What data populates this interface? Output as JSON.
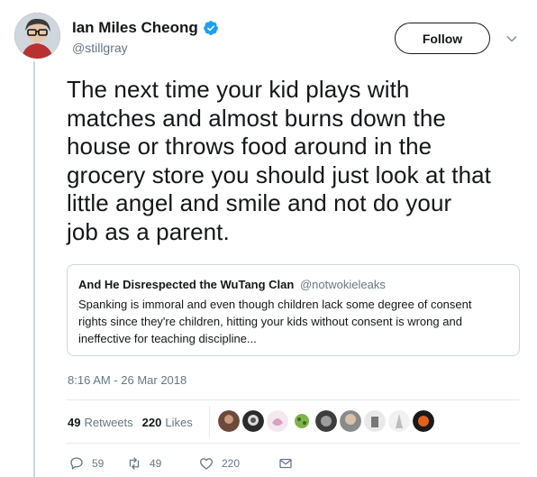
{
  "author": {
    "name": "Ian Miles Cheong",
    "handle": "@stillgray",
    "verified": true
  },
  "follow_label": "Follow",
  "tweet": {
    "lines": [
      "The next time your kid plays with",
      "matches and almost burns down the",
      "house or throws food around in the",
      "grocery store you should just look at that",
      "little angel and smile and not do your",
      "job as a parent."
    ]
  },
  "quote": {
    "name": "And He Disrespected the WuTang Clan",
    "handle": "@notwokieleaks",
    "lines": [
      "Spanking is immoral and even though children lack some degree of consent",
      "rights since they're children, hitting your kids without consent is wrong and",
      "ineffective for teaching discipline..."
    ]
  },
  "timestamp": "8:16 AM - 26 Mar 2018",
  "stats": {
    "retweets_count": "49",
    "retweets_label": "Retweets",
    "likes_count": "220",
    "likes_label": "Likes"
  },
  "likers": [
    {
      "name": "liker-1",
      "color": "#6b4a3a"
    },
    {
      "name": "liker-2",
      "color": "#2b2b2b"
    },
    {
      "name": "liker-3",
      "color": "#f2e8ee"
    },
    {
      "name": "liker-4",
      "color": "#7fb24a"
    },
    {
      "name": "liker-5",
      "color": "#3d3d3d"
    },
    {
      "name": "liker-6",
      "color": "#8a8a8a"
    },
    {
      "name": "liker-7",
      "color": "#e9e9e9"
    },
    {
      "name": "liker-8",
      "color": "#f1f1f1"
    },
    {
      "name": "liker-9",
      "color": "#1a1a1a"
    }
  ],
  "actions": {
    "replies": "59",
    "retweets": "49",
    "likes": "220"
  },
  "colors": {
    "text": "#14171a",
    "secondary": "#657786",
    "border": "#ccd6dd",
    "verified": "#1da1f2"
  }
}
